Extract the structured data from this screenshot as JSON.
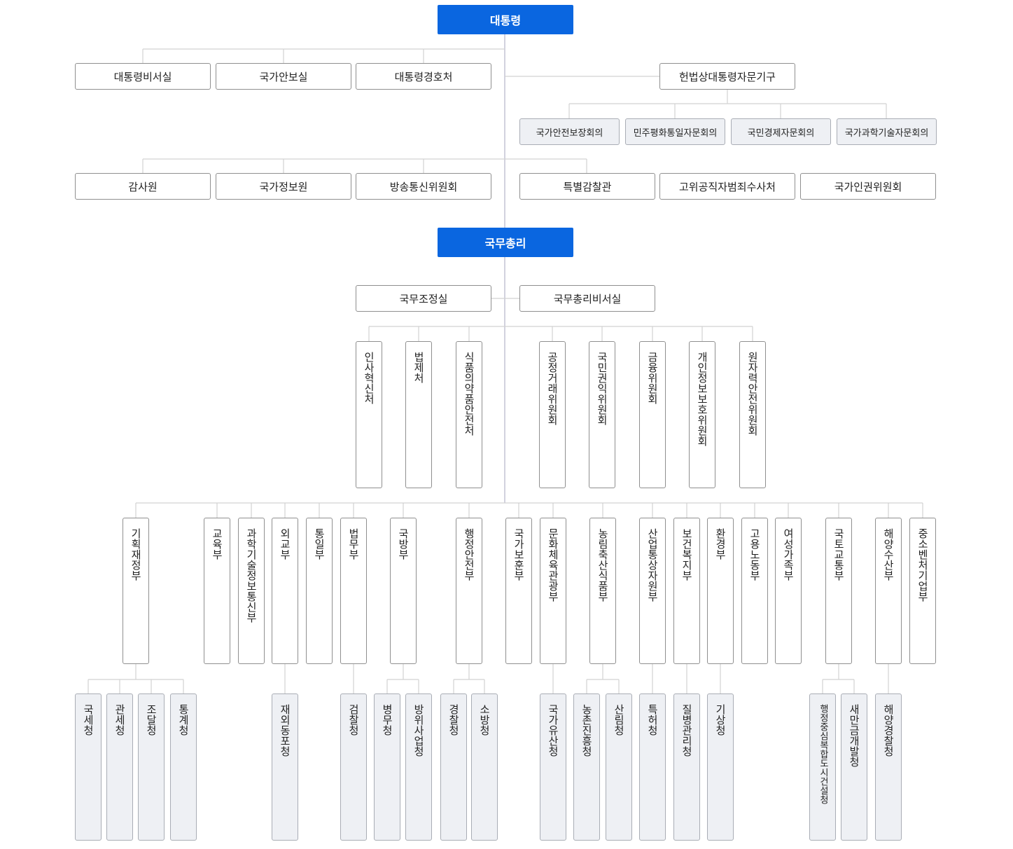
{
  "president": "대통령",
  "pm": "국무총리",
  "president_offices": [
    "대통령비서실",
    "국가안보실",
    "대통령경호처"
  ],
  "advisory_parent": "헌법상대통령자문기구",
  "advisory": [
    "국가안전보장회의",
    "민주평화통일자문회의",
    "국민경제자문회의",
    "국가과학기술자문회의"
  ],
  "agencies_left": [
    "감사원",
    "국가정보원",
    "방송통신위원회"
  ],
  "agencies_right": [
    "특별감찰관",
    "고위공직자범죄수사처",
    "국가인권위원회"
  ],
  "pm_offices": [
    "국무조정실",
    "국무총리비서실"
  ],
  "pm_bodies": [
    "인사혁신처",
    "법제처",
    "식품의약품안전처",
    "공정거래위원회",
    "국민권익위원회",
    "금융위원회",
    "개인정보보호위원회",
    "원자력안전위원회"
  ],
  "ministries": [
    "기획재정부",
    "교육부",
    "과학기술정보통신부",
    "외교부",
    "통일부",
    "법무부",
    "국방부",
    "행정안전부",
    "국가보훈부",
    "문화체육관광부",
    "농림축산식품부",
    "산업통상자원부",
    "보건복지부",
    "환경부",
    "고용노동부",
    "여성가족부",
    "국토교통부",
    "해양수산부",
    "중소벤처기업부"
  ],
  "sub_agencies": [
    "국세청",
    "관세청",
    "조달청",
    "통계청",
    "재외동포청",
    "검찰청",
    "병무청",
    "방위사업청",
    "경찰청",
    "소방청",
    "국가유산청",
    "농촌진흥청",
    "산림청",
    "특허청",
    "질병관리청",
    "기상청",
    "행정중심복합도시건설청",
    "새만금개발청",
    "해양경찰청"
  ],
  "colors": {
    "head": "#0a66e0",
    "line": "#d4d4d4",
    "sub_fill": "#eef0f4"
  }
}
